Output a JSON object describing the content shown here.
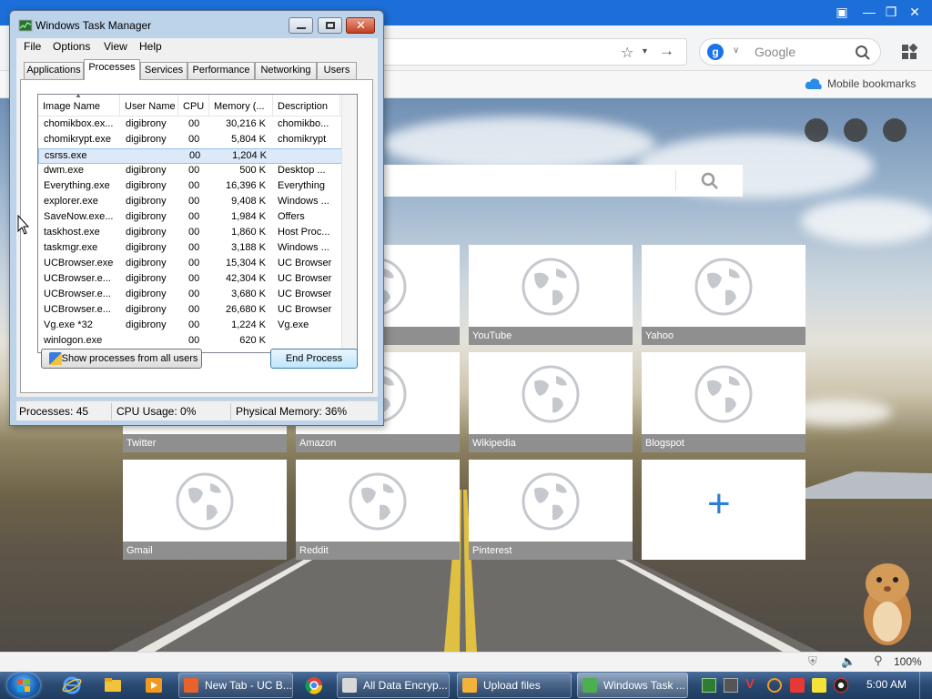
{
  "browser": {
    "search_placeholder": "Google",
    "mobile_bookmarks": "Mobile bookmarks",
    "zoom": "100%",
    "tiles": [
      {
        "label": ""
      },
      {
        "label": "YouTube"
      },
      {
        "label": "Yahoo"
      },
      {
        "label": "Twitter"
      },
      {
        "label": "Amazon"
      },
      {
        "label": "Wikipedia"
      },
      {
        "label": "Blogspot"
      },
      {
        "label": "Gmail"
      },
      {
        "label": "Reddit"
      },
      {
        "label": "Pinterest"
      }
    ],
    "add_tile_symbol": "+",
    "accent": "#1c6fd8"
  },
  "taskmgr": {
    "title": "Windows Task Manager",
    "menu": [
      "File",
      "Options",
      "View",
      "Help"
    ],
    "tabs": [
      "Applications",
      "Processes",
      "Services",
      "Performance",
      "Networking",
      "Users"
    ],
    "active_tab": "Processes",
    "columns": [
      "Image Name",
      "User Name",
      "CPU",
      "Memory (...",
      "Description"
    ],
    "rows": [
      {
        "image": "chomikbox.ex...",
        "user": "digibrony",
        "cpu": "00",
        "mem": "30,216 K",
        "desc": "chomikbo..."
      },
      {
        "image": "chomikrypt.exe",
        "user": "digibrony",
        "cpu": "00",
        "mem": "5,804 K",
        "desc": "chomikrypt"
      },
      {
        "image": "csrss.exe",
        "user": "",
        "cpu": "00",
        "mem": "1,204 K",
        "desc": ""
      },
      {
        "image": "dwm.exe",
        "user": "digibrony",
        "cpu": "00",
        "mem": "500 K",
        "desc": "Desktop ..."
      },
      {
        "image": "Everything.exe",
        "user": "digibrony",
        "cpu": "00",
        "mem": "16,396 K",
        "desc": "Everything"
      },
      {
        "image": "explorer.exe",
        "user": "digibrony",
        "cpu": "00",
        "mem": "9,408 K",
        "desc": "Windows ..."
      },
      {
        "image": "SaveNow.exe...",
        "user": "digibrony",
        "cpu": "00",
        "mem": "1,984 K",
        "desc": "Offers"
      },
      {
        "image": "taskhost.exe",
        "user": "digibrony",
        "cpu": "00",
        "mem": "1,860 K",
        "desc": "Host Proc..."
      },
      {
        "image": "taskmgr.exe",
        "user": "digibrony",
        "cpu": "00",
        "mem": "3,188 K",
        "desc": "Windows ..."
      },
      {
        "image": "UCBrowser.exe",
        "user": "digibrony",
        "cpu": "00",
        "mem": "15,304 K",
        "desc": "UC Browser"
      },
      {
        "image": "UCBrowser.e...",
        "user": "digibrony",
        "cpu": "00",
        "mem": "42,304 K",
        "desc": "UC Browser"
      },
      {
        "image": "UCBrowser.e...",
        "user": "digibrony",
        "cpu": "00",
        "mem": "3,680 K",
        "desc": "UC Browser"
      },
      {
        "image": "UCBrowser.e...",
        "user": "digibrony",
        "cpu": "00",
        "mem": "26,680 K",
        "desc": "UC Browser"
      },
      {
        "image": "Vg.exe *32",
        "user": "digibrony",
        "cpu": "00",
        "mem": "1,224 K",
        "desc": "Vg.exe"
      },
      {
        "image": "winlogon.exe",
        "user": "",
        "cpu": "00",
        "mem": "620 K",
        "desc": ""
      }
    ],
    "selected_row": 2,
    "show_all_label": "Show processes from all users",
    "end_process_label": "End Process",
    "status": {
      "processes": "Processes: 45",
      "cpu": "CPU Usage: 0%",
      "memory": "Physical Memory: 36%"
    }
  },
  "taskbar": {
    "tasks": [
      {
        "label": "New Tab - UC B...",
        "icon": "uc-browser-icon",
        "color": "#e8632b"
      },
      {
        "label": "All Data Encryp...",
        "icon": "window-icon",
        "color": "#d8d8d8"
      },
      {
        "label": "Upload files",
        "icon": "upload-icon",
        "color": "#f2b338"
      },
      {
        "label": "Windows Task ...",
        "icon": "taskmgr-icon",
        "color": "#4caf50"
      }
    ],
    "clock": "5:00 AM"
  }
}
